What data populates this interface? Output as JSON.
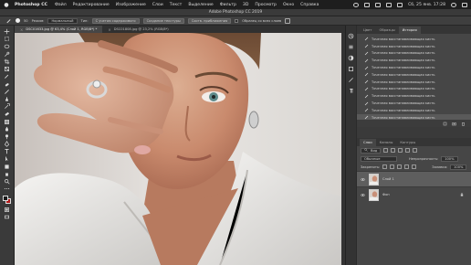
{
  "menubar": {
    "app": "Photoshop CC",
    "items": [
      "Файл",
      "Редактирование",
      "Изображение",
      "Слои",
      "Текст",
      "Выделение",
      "Фильтр",
      "3D",
      "Просмотр",
      "Окно",
      "Справка"
    ],
    "datetime": "Сб, 25 янв. 17:28"
  },
  "window": {
    "title": "Adobe Photoshop CC 2019"
  },
  "options": {
    "brush_size": "50",
    "mode_label": "Режим:",
    "mode_value": "Нормальный",
    "type_label": "Тип:",
    "btn_content": "С учетом содержимого",
    "btn_texture": "Создание текстуры",
    "btn_approx": "Соотв. приближения",
    "sample_label": "Образец со всех слоев"
  },
  "tabs": [
    {
      "label": "DSC01633.jpg @ 63,4% (Слой 1, RGB/8*) *",
      "close": "×"
    },
    {
      "label": "DSC01808.jpg @ 23,2% (RGB/8*)",
      "close": "×"
    }
  ],
  "history": {
    "tabs": [
      "Цвет",
      "Образцы",
      "История"
    ],
    "active_tab": 2,
    "items": [
      "Точечная восстанавливающая кисть",
      "Точечная восстанавливающая кисть",
      "Точечная восстанавливающая кисть",
      "Точечная восстанавливающая кисть",
      "Точечная восстанавливающая кисть",
      "Точечная восстанавливающая кисть",
      "Точечная восстанавливающая кисть",
      "Точечная восстанавливающая кисть",
      "Точечная восстанавливающая кисть",
      "Точечная восстанавливающая кисть",
      "Точечная восстанавливающая кисть",
      "Точечная восстанавливающая кисть"
    ]
  },
  "layers": {
    "tabs": [
      "Слои",
      "Каналы",
      "Контуры"
    ],
    "active_tab": 0,
    "filter_value": "Вид",
    "blend_mode": "Обычные",
    "opacity_label": "Непрозрачность:",
    "opacity_value": "100%",
    "lock_label": "Закрепить:",
    "fill_label": "Заливка:",
    "fill_value": "100%",
    "items": [
      {
        "name": "Слой 1",
        "selected": true
      },
      {
        "name": "Фон",
        "selected": false
      }
    ]
  },
  "colors": {
    "foreground": "#1a1a1a",
    "background": "#b01818",
    "panel": "#464646",
    "selection": "#5e5e5e"
  }
}
